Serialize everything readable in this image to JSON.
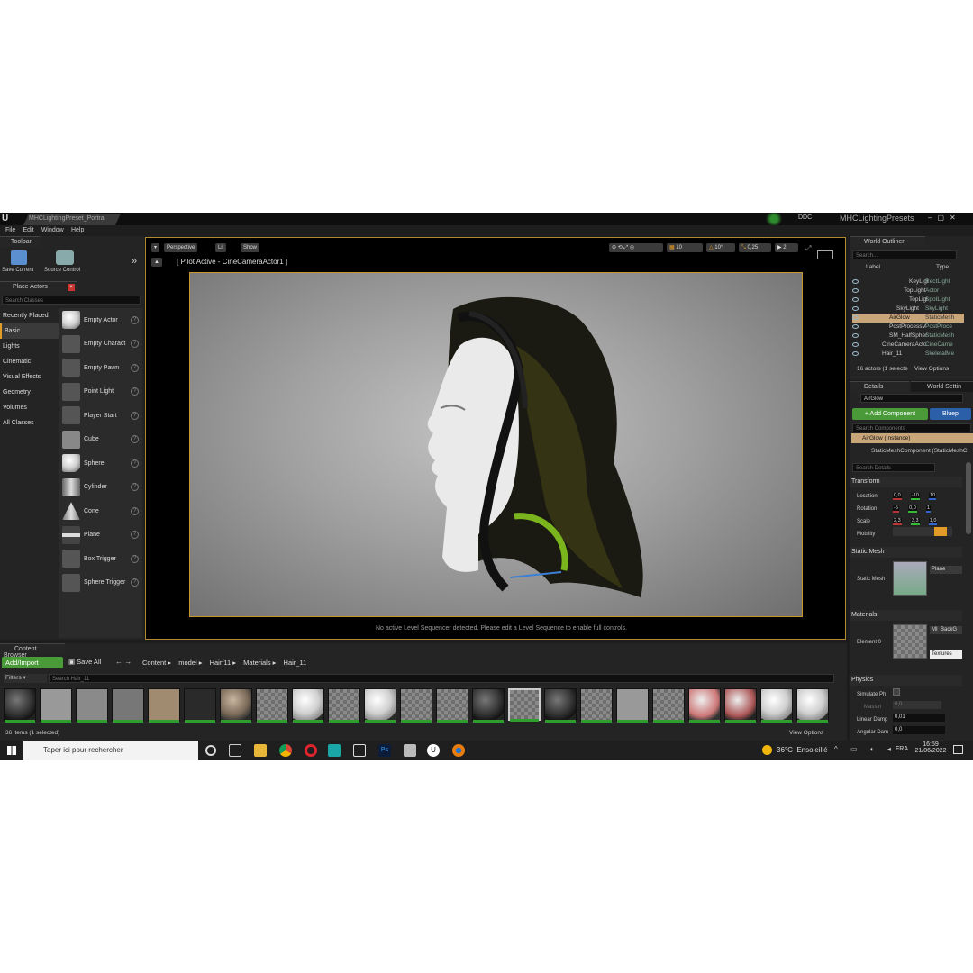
{
  "window": {
    "tab_title": "MHCLightingPreset_Portra",
    "project_name": "MHCLightingPresets",
    "ddc_label": "DDC"
  },
  "menu": [
    "File",
    "Edit",
    "Window",
    "Help"
  ],
  "toolbar": {
    "title": "Toolbar",
    "save_label": "Save Current",
    "source_control_label": "Source Control"
  },
  "place_actors": {
    "title": "Place Actors",
    "search_placeholder": "Search Classes",
    "categories": [
      "Recently Placed",
      "Basic",
      "Lights",
      "Cinematic",
      "Visual Effects",
      "Geometry",
      "Volumes",
      "All Classes"
    ],
    "items": [
      "Empty Actor",
      "Empty Charact",
      "Empty Pawn",
      "Point Light",
      "Player Start",
      "Cube",
      "Sphere",
      "Cylinder",
      "Cone",
      "Plane",
      "Box Trigger",
      "Sphere Trigger"
    ]
  },
  "viewport": {
    "perspective": "Perspective",
    "lit": "Lit",
    "show": "Show",
    "pilot_label": "[ Pilot Active - CineCameraActor1 ]",
    "grid_snap": "10",
    "rot_snap": "10°",
    "scale_snap": "0,25",
    "cam_speed": "2",
    "sequencer_msg": "No active Level Sequencer detected. Please edit a Level Sequence to enable full controls."
  },
  "outliner": {
    "title": "World Outliner",
    "search_placeholder": "Search...",
    "col_label": "Label",
    "col_type": "Type",
    "rows": [
      {
        "label": "KeyLigl",
        "type": "RectLight"
      },
      {
        "label": "TopLight",
        "type": "Actor"
      },
      {
        "label": "TopLigl",
        "type": "SpotLight"
      },
      {
        "label": "SkyLight",
        "type": "SkyLight"
      },
      {
        "label": "AirGlow",
        "type": "StaticMesh"
      },
      {
        "label": "PostProcessV",
        "type": "PostProce"
      },
      {
        "label": "SM_HalfSpher",
        "type": "StaticMesh"
      },
      {
        "label": "CineCameraActo",
        "type": "CineCame"
      },
      {
        "label": "Hair_11",
        "type": "SkeletalMe"
      }
    ],
    "footer": "16 actors (1 selecte",
    "view_options": "View Options"
  },
  "details": {
    "tab_details": "Details",
    "tab_world": "World Settin",
    "actor_name": "AirGlow",
    "add_component": "+ Add Component",
    "blueprint": "Bluep",
    "search_components": "Search Components",
    "instance_label": "AirGlow (Instance)",
    "component_label": "StaticMeshComponent (StaticMeshC",
    "search_details": "Search Details",
    "transform_title": "Transform",
    "location_label": "Location",
    "rotation_label": "Rotation",
    "scale_label": "Scale",
    "mobility_label": "Mobility",
    "location": [
      "0,0",
      "-10",
      "10"
    ],
    "rotation": [
      "-5",
      "0,0",
      "1"
    ],
    "scale": [
      "2,3",
      "3,3",
      "1,0"
    ],
    "static_mesh_title": "Static Mesh",
    "static_mesh_label": "Static Mesh",
    "static_mesh_value": "Plane",
    "materials_title": "Materials",
    "element_label": "Element 0",
    "material_value": "MI_BackG",
    "textures_label": "Textures",
    "physics_title": "Physics",
    "simulate_label": "Simulate Ph",
    "mass_label": "MassIn",
    "mass_value": "0,0",
    "linear_damp_label": "Linear Damp",
    "linear_damp_value": "0,01",
    "angular_damp_label": "Angular Dam",
    "angular_damp_value": "0,0"
  },
  "content_browser": {
    "title": "Content Browser",
    "add_import": "Add/Import",
    "save_all": "Save All",
    "path": [
      "Content",
      "model",
      "Hairf11",
      "Materials",
      "Hair_11"
    ],
    "filters": "Filters",
    "search_placeholder": "Search Hair_11",
    "status": "36 items (1 selected)",
    "view_options": "View Options"
  },
  "taskbar": {
    "search_placeholder": "Taper ici pour rechercher",
    "weather": "36°C  Ensoleillé",
    "lang": "FRA",
    "time": "16:59",
    "date": "21/06/2022"
  }
}
